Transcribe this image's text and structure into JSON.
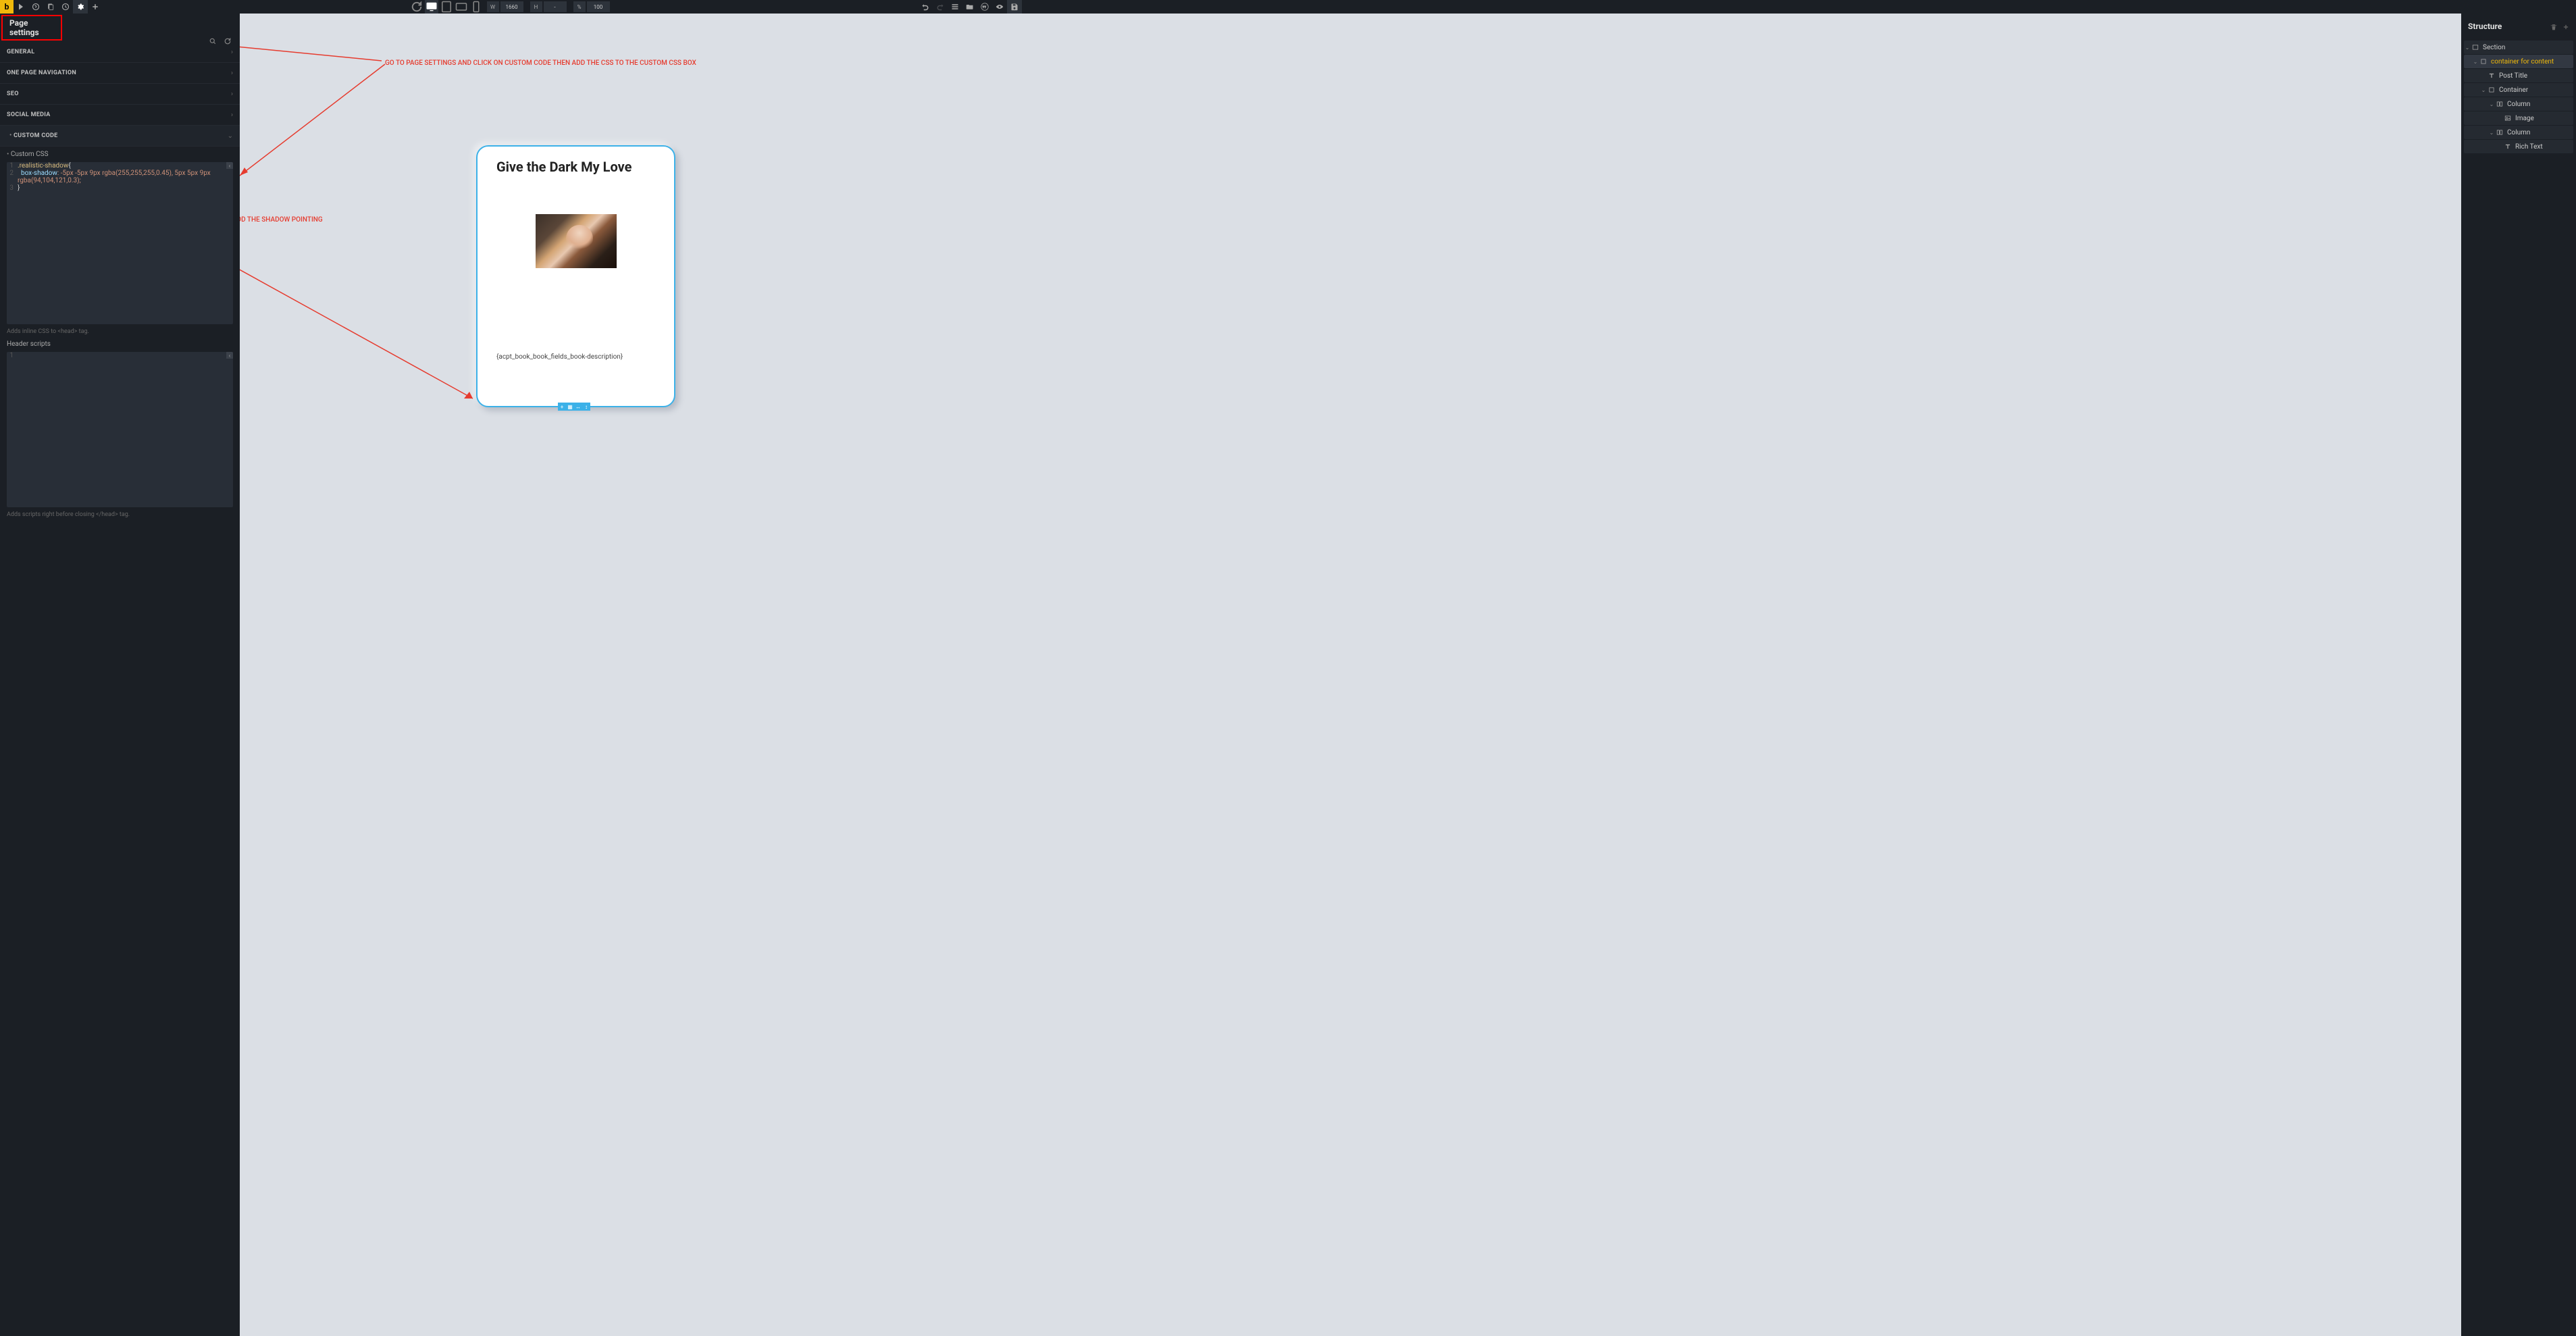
{
  "topbar": {
    "logo": "b",
    "dimensions": {
      "w_label": "W",
      "w_value": "1660",
      "h_label": "H",
      "h_value": "-",
      "zoom_label": "%",
      "zoom_value": "100"
    }
  },
  "leftPanel": {
    "title": "Page settings",
    "sections": {
      "general": "GENERAL",
      "onePage": "ONE PAGE NAVIGATION",
      "seo": "SEO",
      "social": "SOCIAL MEDIA",
      "customCode": "CUSTOM CODE",
      "customCss": "Custom CSS",
      "headerScripts": "Header scripts"
    },
    "cssHint": "Adds inline CSS to <head> tag.",
    "headerHint": "Adds scripts right before closing </head> tag.",
    "code": {
      "l1_sel": ".realistic-shadow",
      "l1_brace": "{",
      "l2_prop": "box-shadow",
      "l2_rest": ": -5px -5px 9px rgba(255,255,255,0.45), 5px 5px 9px",
      "l2b": "rgba(94,104,121,0.3);",
      "l3": "}"
    }
  },
  "canvas": {
    "cardTitle": "Give the Dark My Love",
    "cardDesc": "{acpt_book_book_fields_book-description}"
  },
  "rightPanel": {
    "title": "Structure",
    "tree": [
      {
        "label": "Section",
        "indent": 0,
        "icon": "section",
        "toggle": true
      },
      {
        "label": "container for content",
        "indent": 1,
        "icon": "container",
        "toggle": true,
        "selected": true
      },
      {
        "label": "Post Title",
        "indent": 2,
        "icon": "text",
        "toggle": false
      },
      {
        "label": "Container",
        "indent": 2,
        "icon": "container",
        "toggle": true
      },
      {
        "label": "Column",
        "indent": 3,
        "icon": "column",
        "toggle": true
      },
      {
        "label": "Image",
        "indent": 4,
        "icon": "image",
        "toggle": false
      },
      {
        "label": "Column",
        "indent": 3,
        "icon": "column",
        "toggle": true
      },
      {
        "label": "Rich Text",
        "indent": 4,
        "icon": "text",
        "toggle": false
      }
    ]
  },
  "annotations": {
    "a1": "GO TO PAGE SETTINGS AND CLICK ON CUSTOM CODE THEN ADD THE CSS TO THE CUSTOM CSS BOX",
    "a2": "THIS LINE OF CSS WILL ADD THE SHADOW POINTING"
  }
}
